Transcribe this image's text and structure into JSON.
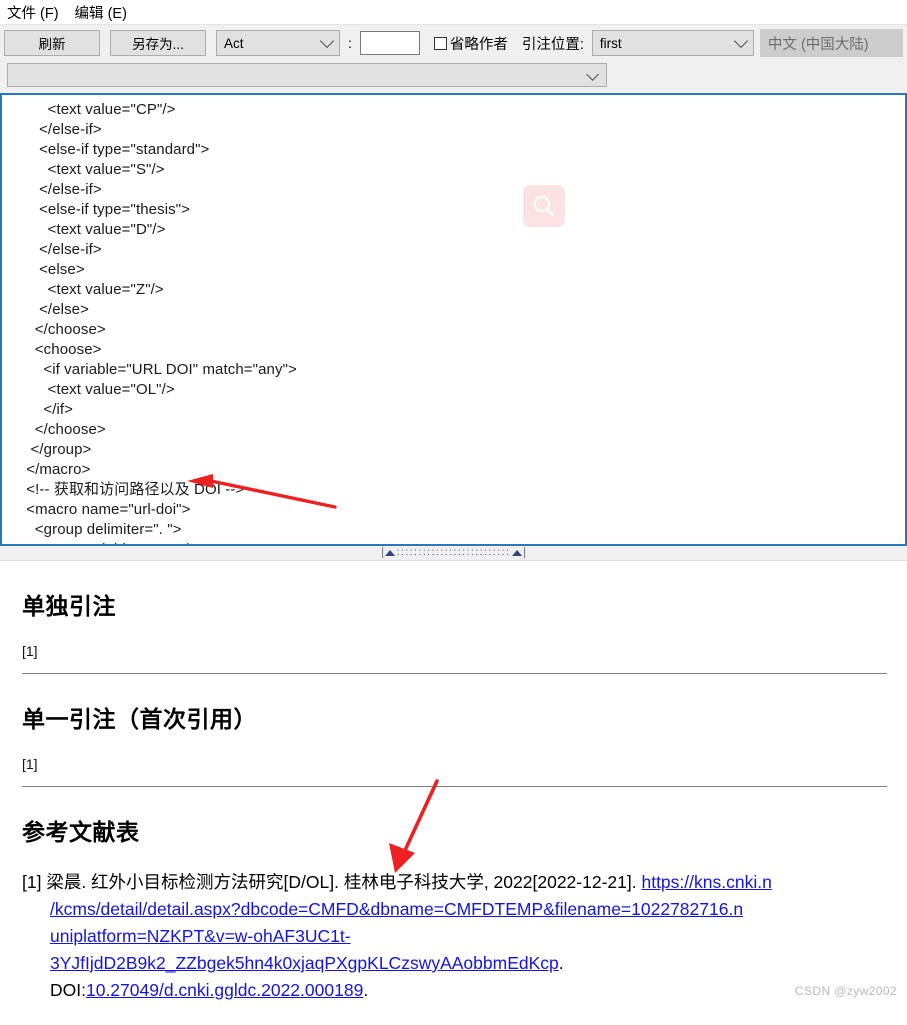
{
  "menubar": {
    "items": [
      {
        "label": "文件 (F)",
        "name": "menu-file"
      },
      {
        "label": "编辑 (E)",
        "name": "menu-edit"
      }
    ]
  },
  "toolbar": {
    "refresh_label": "刷新",
    "saveas_label": "另存为...",
    "type_combo_value": "Act",
    "separator_label": ":",
    "number_input_value": "",
    "number_input_placeholder": "",
    "omit_author_label": "省略作者",
    "omit_author_checked": false,
    "cite_position_label": "引注位置:",
    "cite_position_value": "first",
    "language_label": "中文 (中国大陆)",
    "wide_combo_value": "",
    "colors": {
      "toolbar_bg": "#f0f0f0",
      "button_face": "#e1e1e1",
      "disabled_bg": "#cdcdcd",
      "disabled_text": "#6d6d6d"
    }
  },
  "editor": {
    "border_color": "#2878be",
    "overlay_icon": "search-icon",
    "overlay_icon_bg": "#fbe3e4",
    "lines": [
      "      <text value=\"CP\"/>",
      "    </else-if>",
      "    <else-if type=\"standard\">",
      "      <text value=\"S\"/>",
      "    </else-if>",
      "    <else-if type=\"thesis\">",
      "      <text value=\"D\"/>",
      "    </else-if>",
      "    <else>",
      "      <text value=\"Z\"/>",
      "    </else>",
      "   </choose>",
      "   <choose>",
      "     <if variable=\"URL DOI\" match=\"any\">",
      "      <text value=\"OL\"/>",
      "     </if>",
      "   </choose>",
      "  </group>",
      " </macro>",
      " <!-- 获取和访问路径以及 DOI -->",
      " <macro name=\"url-doi\">",
      "   <group delimiter=\". \">",
      "     <text variable=\"URL\"/>"
    ]
  },
  "annotations": {
    "arrow_color": "#ef2020",
    "arrow1_target": "text value=\"OL\"/>",
    "arrow2_target": "[D/OL]"
  },
  "document": {
    "sections": [
      {
        "heading": "单独引注",
        "citation": "[1]"
      },
      {
        "heading": "单一引注（首次引用）",
        "citation": "[1]"
      }
    ],
    "bibliography_heading": "参考文献表",
    "reference": {
      "marker": "[1]",
      "lines": [
        {
          "segments": [
            {
              "text": "[1] 梁晨. 红外小目标检测方法研究[D/OL]. 桂林电子科技大学, 2022[2022-12-21]. ",
              "link": false
            },
            {
              "text": "https://kns.cnki.n",
              "link": true
            }
          ],
          "indent": false
        },
        {
          "segments": [
            {
              "text": "/kcms/detail/detail.aspx?dbcode=CMFD&dbname=CMFDTEMP&filename=1022782716.n",
              "link": true
            }
          ],
          "indent": true
        },
        {
          "segments": [
            {
              "text": "uniplatform=NZKPT&v=w-ohAF3UC1t-",
              "link": true
            }
          ],
          "indent": true
        },
        {
          "segments": [
            {
              "text": "3YJfIjdD2B9k2_ZZbgek5hn4k0xjaqPXgpKLCzswyAAobbmEdKcp",
              "link": true
            },
            {
              "text": ".",
              "link": false
            }
          ],
          "indent": true
        },
        {
          "segments": [
            {
              "text": "DOI:",
              "link": false
            },
            {
              "text": "10.27049/d.cnki.ggldc.2022.000189",
              "link": true
            },
            {
              "text": ".",
              "link": false
            }
          ],
          "indent": true
        }
      ],
      "link_color": "#1414e0"
    }
  },
  "watermark": "CSDN @zyw2002"
}
